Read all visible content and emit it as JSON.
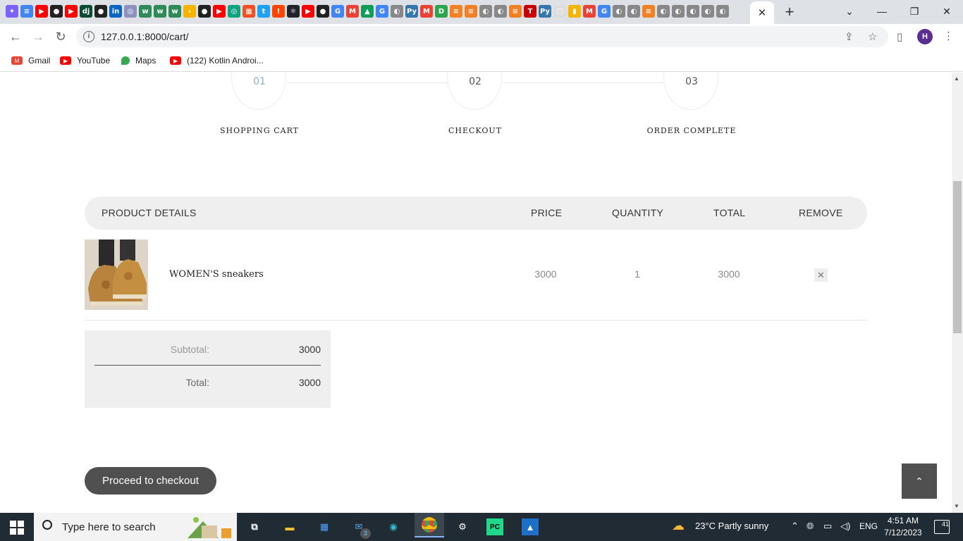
{
  "browser": {
    "url": "127.0.0.1:8000/cart/",
    "close_tab": "✕",
    "new_tab": "+",
    "profile_initial": "H",
    "bookmarks": [
      {
        "label": "Gmail",
        "icon": "gmail-icon",
        "color": "#ea4335"
      },
      {
        "label": "YouTube",
        "icon": "youtube-icon",
        "color": "#ff0000"
      },
      {
        "label": "Maps",
        "icon": "maps-icon",
        "color": "#34a853"
      },
      {
        "label": "(122) Kotlin Androi...",
        "icon": "youtube-icon",
        "color": "#ff0000"
      }
    ]
  },
  "steps": [
    {
      "num": "01",
      "label": "SHOPPING CART",
      "active": true
    },
    {
      "num": "02",
      "label": "CHECKOUT",
      "active": false
    },
    {
      "num": "03",
      "label": "ORDER COMPLETE",
      "active": false
    }
  ],
  "cart": {
    "headers": {
      "product": "PRODUCT DETAILS",
      "price": "PRICE",
      "quantity": "QUANTITY",
      "total": "TOTAL",
      "remove": "REMOVE"
    },
    "items": [
      {
        "name": "WOMEN'S sneakers",
        "price": "3000",
        "quantity": "1",
        "total": "3000",
        "remove": "✕"
      }
    ]
  },
  "totals": {
    "subtotal_label": "Subtotal:",
    "subtotal_value": "3000",
    "total_label": "Total:",
    "total_value": "3000"
  },
  "checkout_label": "Proceed to checkout",
  "to_top_icon": "⌃",
  "taskbar": {
    "search_placeholder": "Type here to search",
    "weather": "23°C  Partly sunny",
    "language": "ENG",
    "time": "4:51 AM",
    "date": "7/12/2023",
    "notifications": "41",
    "mail_badge": "3"
  },
  "colors": {
    "accent": "#505050",
    "header_bg": "#efefef",
    "active_step": "#8ab3c2"
  }
}
